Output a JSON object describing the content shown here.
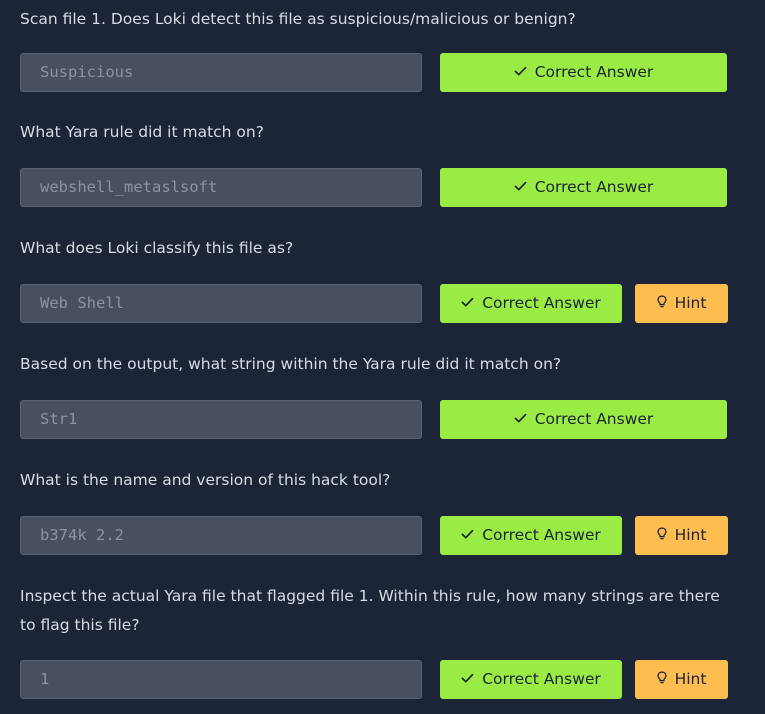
{
  "questions": [
    {
      "text": "Scan file 1. Does Loki detect this file as suspicious/malicious or benign?",
      "answer": "Suspicious",
      "correct_label": "Correct Answer",
      "has_hint": false
    },
    {
      "text": "What Yara rule did it match on?",
      "answer": "webshell_metaslsoft",
      "correct_label": "Correct Answer",
      "has_hint": false
    },
    {
      "text": "What does Loki classify this file as?",
      "answer": "Web Shell",
      "correct_label": "Correct Answer",
      "has_hint": true,
      "hint_label": "Hint"
    },
    {
      "text": "Based on the output, what string within the Yara rule did it match on?",
      "answer": "Str1",
      "correct_label": "Correct Answer",
      "has_hint": false
    },
    {
      "text": "What is the name and version of this hack tool?",
      "answer": "b374k 2.2",
      "correct_label": "Correct Answer",
      "has_hint": true,
      "hint_label": "Hint"
    },
    {
      "text": "Inspect the actual Yara file that flagged file 1. Within this rule, how many strings are there to flag this file?",
      "answer": "1",
      "correct_label": "Correct Answer",
      "has_hint": true,
      "hint_label": "Hint"
    }
  ],
  "colors": {
    "background": "#1c2538",
    "correct_button": "#9aeb44",
    "hint_button": "#fdbd4f",
    "answer_field": "#474f61"
  },
  "icons": {
    "correct": "check-icon",
    "hint": "lightbulb-icon"
  }
}
